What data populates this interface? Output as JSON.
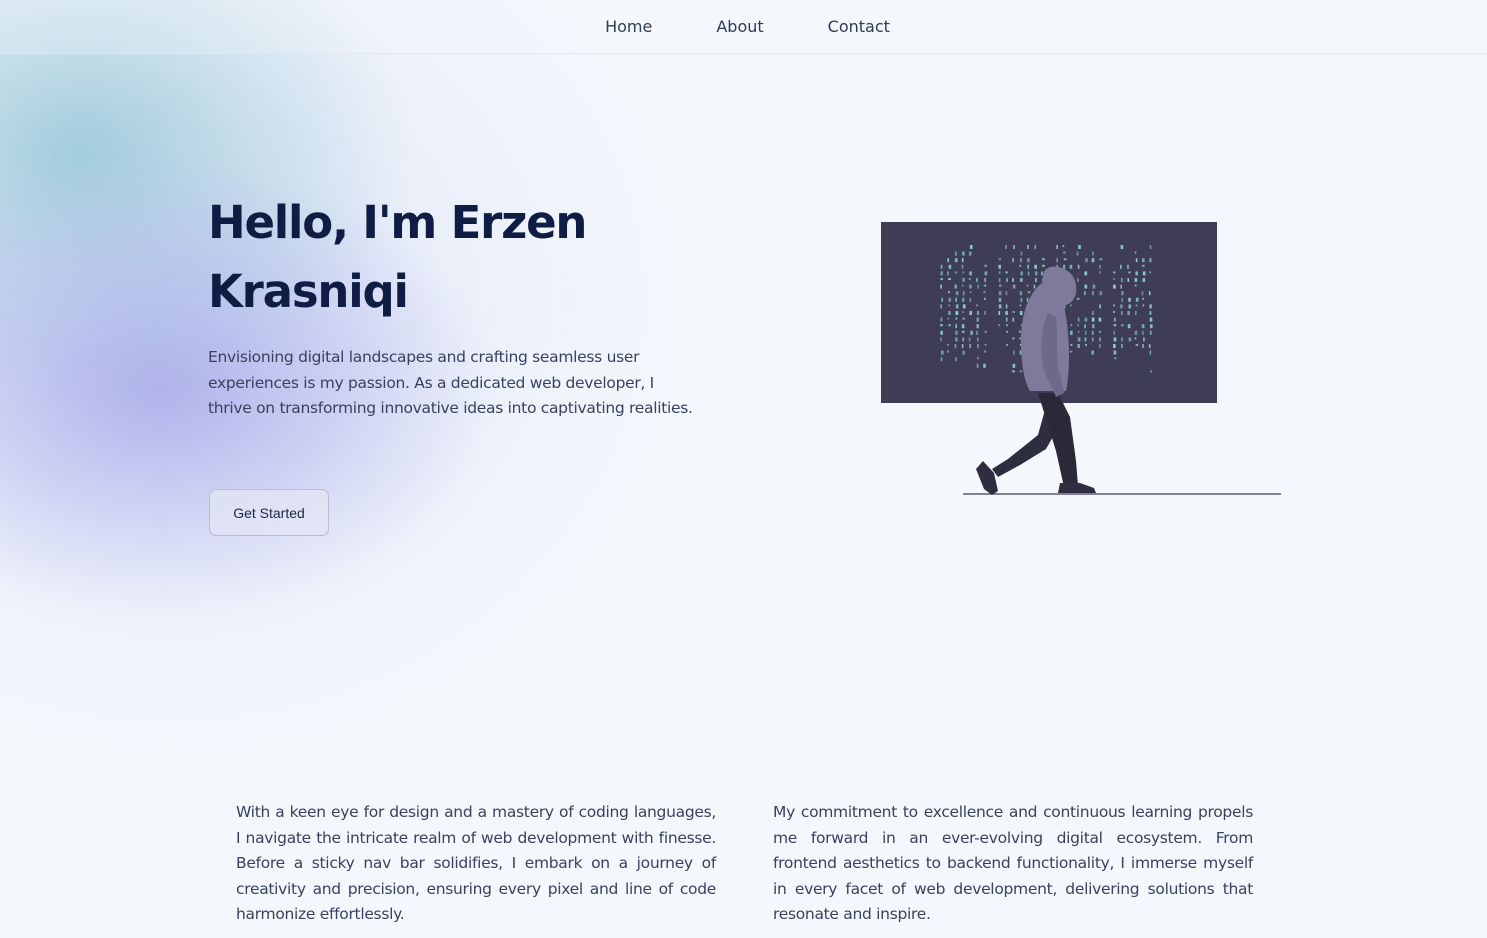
{
  "nav": {
    "links": [
      {
        "label": "Home"
      },
      {
        "label": "About"
      },
      {
        "label": "Contact"
      }
    ]
  },
  "hero": {
    "title": "Hello, I'm Erzen Krasniqi",
    "description": "Envisioning digital landscapes and crafting seamless user experiences is my passion. As a dedicated web developer, I thrive on transforming innovative ideas into captivating realities.",
    "cta_label": "Get Started",
    "illustration_icon": "hooded-person-walking-past-code-screen-illustration"
  },
  "about": {
    "left_paragraph": "With a keen eye for design and a mastery of coding languages, I navigate the intricate realm of web development with finesse. Before a sticky nav bar solidifies, I embark on a journey of creativity and precision, ensuring every pixel and line of code harmonize effortlessly.",
    "right_paragraph": "My commitment to excellence and continuous learning propels me forward in an ever-evolving digital ecosystem. From frontend aesthetics to backend functionality, I immerse myself in every facet of web development, delivering solutions that resonate and inspire."
  },
  "colors": {
    "background": "#f4f7fc",
    "heading": "#0f1c44",
    "body_text": "#38425e",
    "screen": "#3f3d56",
    "code_glyphs": "#8ccfd0",
    "hoodie": "#7d7a9b",
    "pants": "#2f2e41"
  }
}
